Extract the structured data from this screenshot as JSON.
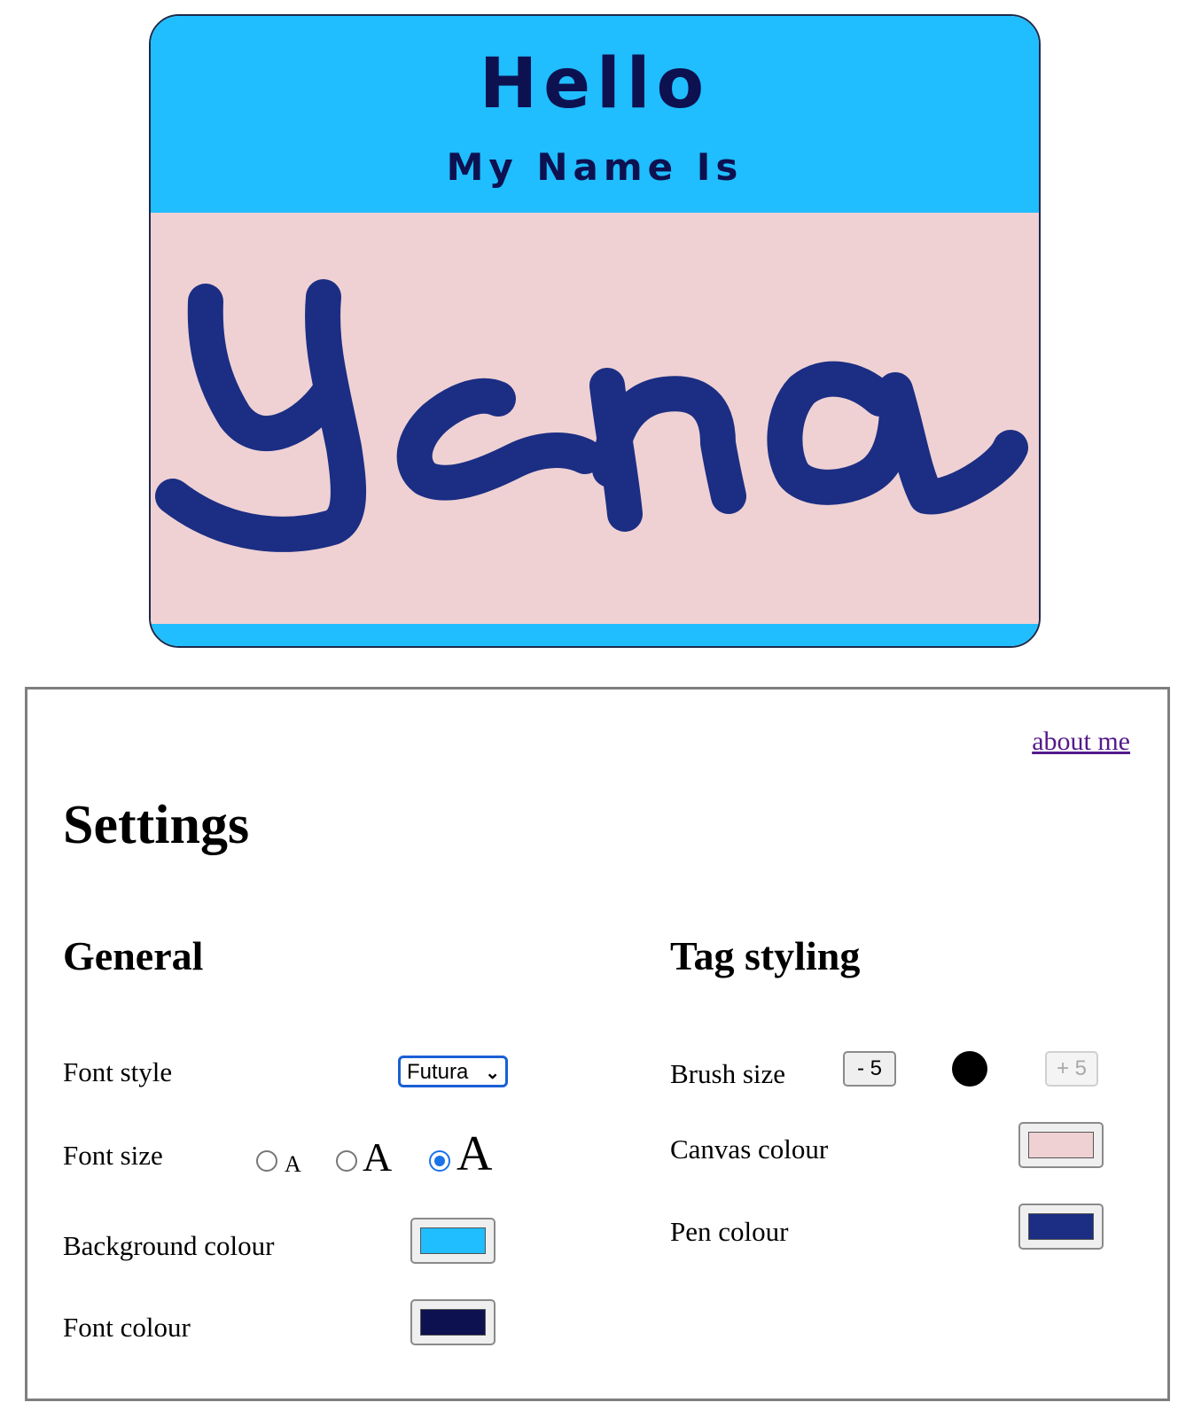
{
  "tag": {
    "title": "Hello",
    "subtitle": "My Name Is",
    "handwritten_name": "Yana",
    "colors": {
      "background": "#20bdff",
      "font": "#0d1150",
      "canvas": "#efd1d4",
      "pen": "#1b2e83"
    }
  },
  "settings": {
    "about_link": "about me",
    "heading": "Settings",
    "general": {
      "heading": "General",
      "font_style": {
        "label": "Font style",
        "value": "Futura"
      },
      "font_size": {
        "label": "Font size",
        "options": [
          "A",
          "A",
          "A"
        ],
        "selected": "large"
      },
      "background_colour": {
        "label": "Background colour",
        "value": "#20bdff"
      },
      "font_colour": {
        "label": "Font colour",
        "value": "#0d1150"
      }
    },
    "tag_styling": {
      "heading": "Tag styling",
      "brush_size": {
        "label": "Brush size",
        "decrease": "- 5",
        "increase": "+ 5",
        "increase_disabled": true
      },
      "canvas_colour": {
        "label": "Canvas colour",
        "value": "#efd1d4"
      },
      "pen_colour": {
        "label": "Pen colour",
        "value": "#1b2e83"
      }
    }
  }
}
